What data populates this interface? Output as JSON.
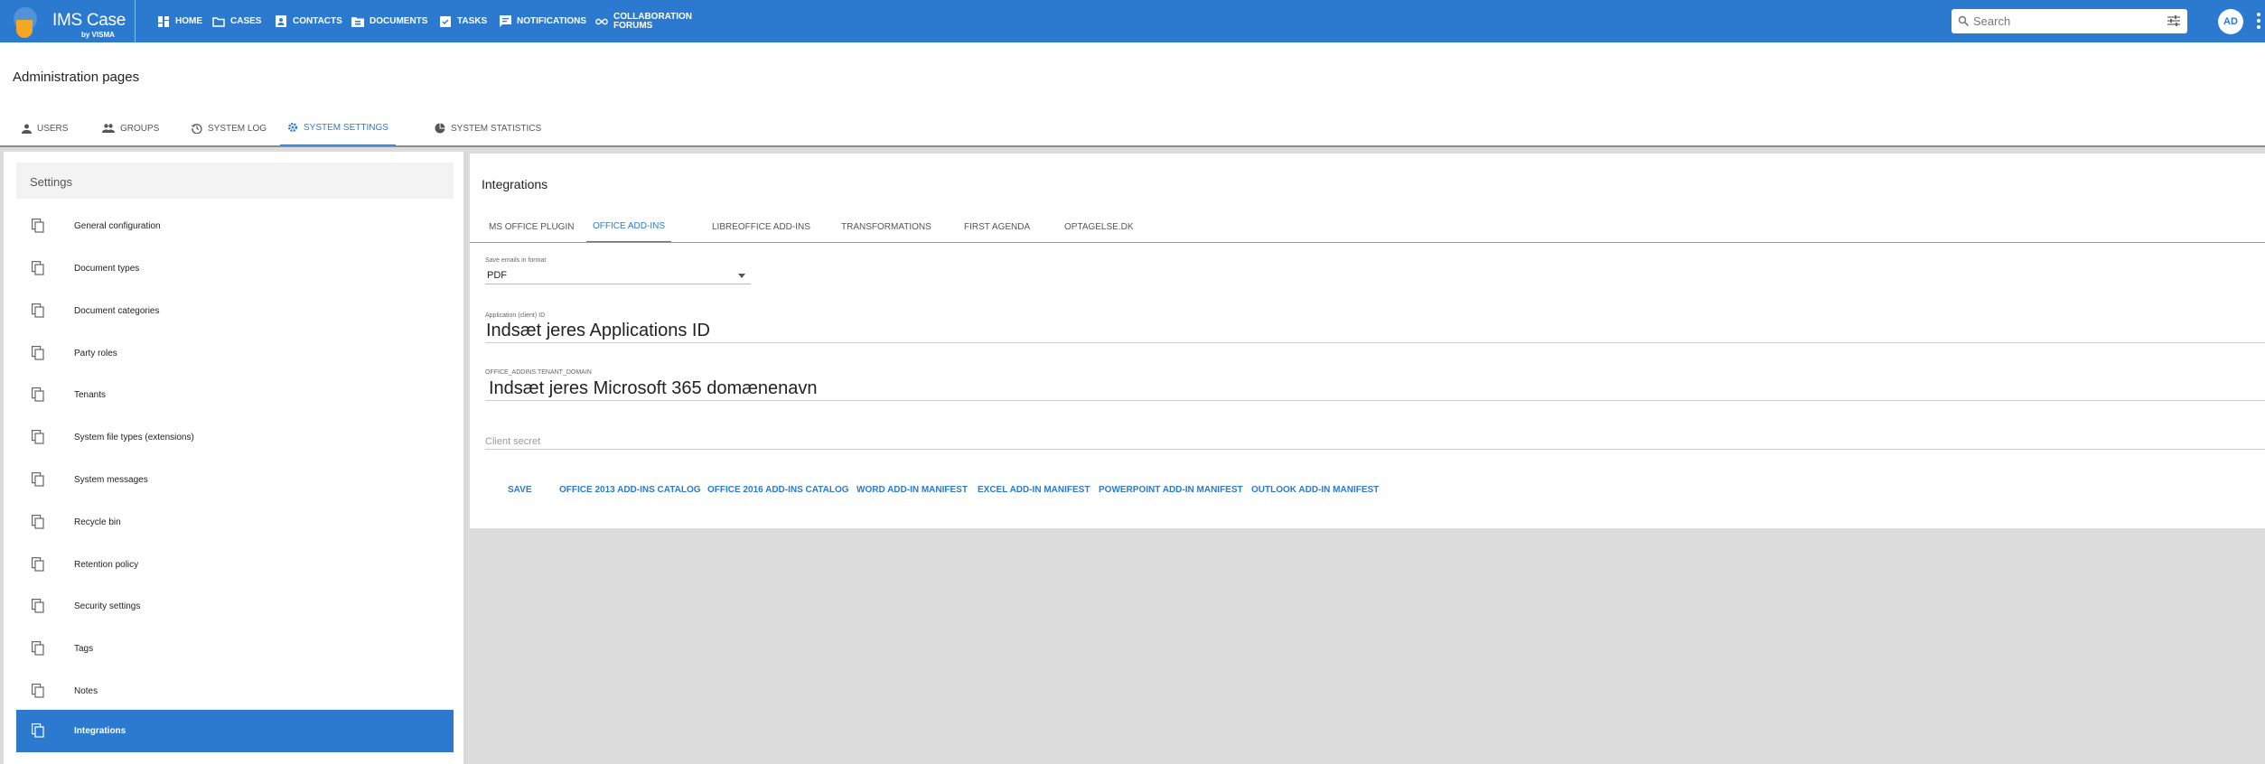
{
  "app": {
    "logo_name": "IMS Case",
    "logo_sub": "by VISMA",
    "nav": [
      {
        "label": "HOME",
        "icon": "dashboard-icon"
      },
      {
        "label": "CASES",
        "icon": "folder-icon"
      },
      {
        "label": "CONTACTS",
        "icon": "contact-card-icon"
      },
      {
        "label": "DOCUMENTS",
        "icon": "document-folder-icon"
      },
      {
        "label": "TASKS",
        "icon": "task-icon"
      },
      {
        "label": "NOTIFICATIONS",
        "icon": "comment-icon"
      },
      {
        "label_line1": "COLLABORATION",
        "label_line2": "FORUMS",
        "icon": "infinity-icon"
      }
    ],
    "search_placeholder": "Search",
    "avatar_initials": "AD",
    "brand_color": "#2b7ad0",
    "accent_color": "#f5a623"
  },
  "page": {
    "title": "Administration pages",
    "tabs": [
      {
        "label": "USERS",
        "icon": "person-icon"
      },
      {
        "label": "GROUPS",
        "icon": "group-icon"
      },
      {
        "label": "SYSTEM LOG",
        "icon": "history-icon"
      },
      {
        "label": "SYSTEM SETTINGS",
        "icon": "gear-icon",
        "active": true
      },
      {
        "label": "SYSTEM STATISTICS",
        "icon": "pie-chart-icon"
      }
    ]
  },
  "sidebar": {
    "title": "Settings",
    "items": [
      {
        "label": "General configuration"
      },
      {
        "label": "Document types"
      },
      {
        "label": "Document categories"
      },
      {
        "label": "Party roles"
      },
      {
        "label": "Tenants"
      },
      {
        "label": "System file types (extensions)"
      },
      {
        "label": "System messages"
      },
      {
        "label": "Recycle bin"
      },
      {
        "label": "Retention policy"
      },
      {
        "label": "Security settings"
      },
      {
        "label": "Tags"
      },
      {
        "label": "Notes"
      },
      {
        "label": "Integrations",
        "active": true
      }
    ]
  },
  "integrations": {
    "title": "Integrations",
    "tabs": [
      {
        "label": "MS OFFICE PLUGIN"
      },
      {
        "label": "OFFICE ADD-INS",
        "active": true
      },
      {
        "label": "LIBREOFFICE ADD-INS"
      },
      {
        "label": "TRANSFORMATIONS"
      },
      {
        "label": "FIRST AGENDA"
      },
      {
        "label": "OPTAGELSE.DK"
      }
    ],
    "save_format_label": "Save emails in format",
    "save_format_value": "PDF",
    "app_id_label": "Application (client) ID",
    "app_id_value": "Indsæt jeres Applications ID",
    "tenant_label": "OFFICE_ADDINS.TENANT_DOMAIN",
    "tenant_value": "Indsæt jeres Microsoft 365 domænenavn",
    "client_secret_placeholder": "Client secret",
    "actions": [
      {
        "label": "SAVE"
      },
      {
        "label": "OFFICE 2013 ADD-INS CATALOG"
      },
      {
        "label": "OFFICE 2016 ADD-INS CATALOG"
      },
      {
        "label": "WORD ADD-IN MANIFEST"
      },
      {
        "label": "EXCEL ADD-IN MANIFEST"
      },
      {
        "label": "POWERPOINT ADD-IN MANIFEST"
      },
      {
        "label": "OUTLOOK ADD-IN MANIFEST"
      }
    ]
  }
}
